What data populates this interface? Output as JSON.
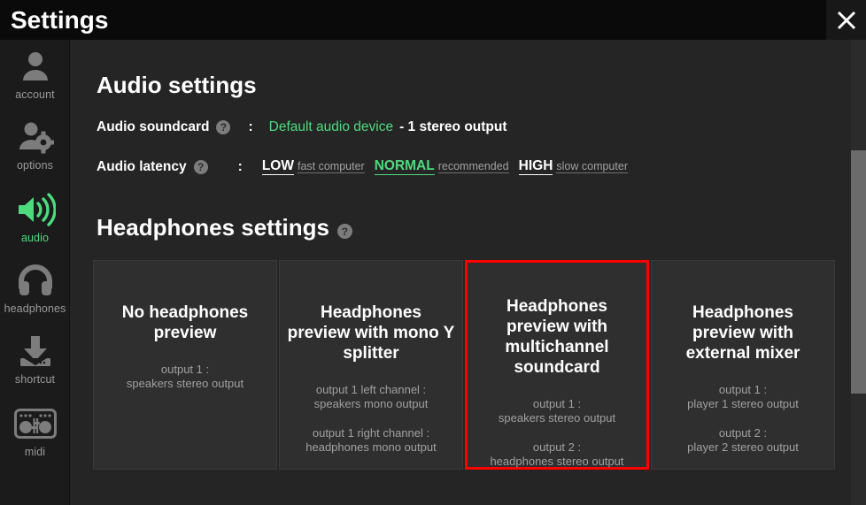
{
  "window": {
    "title": "Settings",
    "close_icon": "close-icon"
  },
  "sidebar": {
    "items": [
      {
        "id": "account",
        "label": "account",
        "icon": "user-icon",
        "active": false
      },
      {
        "id": "options",
        "label": "options",
        "icon": "user-gear-icon",
        "active": false
      },
      {
        "id": "audio",
        "label": "audio",
        "icon": "speaker-icon",
        "active": true
      },
      {
        "id": "headphones",
        "label": "headphones",
        "icon": "headphones-icon",
        "active": false
      },
      {
        "id": "shortcut",
        "label": "shortcut",
        "icon": "download-icon",
        "active": false
      },
      {
        "id": "midi",
        "label": "midi",
        "icon": "midi-controller-icon",
        "active": false
      }
    ]
  },
  "audio_settings": {
    "heading": "Audio settings",
    "soundcard": {
      "label": "Audio soundcard",
      "help_icon": "help-icon",
      "separator": ":",
      "device_name": "Default audio device",
      "device_detail": "- 1 stereo output"
    },
    "latency": {
      "label": "Audio latency",
      "help_icon": "help-icon",
      "separator": ":",
      "options": [
        {
          "name": "LOW",
          "hint": "fast computer",
          "selected": false
        },
        {
          "name": "NORMAL",
          "hint": "recommended",
          "selected": true
        },
        {
          "name": "HIGH",
          "hint": "slow computer",
          "selected": false
        }
      ]
    }
  },
  "headphones_settings": {
    "heading": "Headphones settings",
    "help_icon": "help-icon",
    "cards": [
      {
        "title": "No headphones preview",
        "lines": [
          "output 1 :\nspeakers stereo output"
        ],
        "selected": false
      },
      {
        "title": "Headphones preview with mono Y splitter",
        "lines": [
          "output 1 left channel :\nspeakers mono output",
          "output 1 right channel :\nheadphones mono output"
        ],
        "selected": false
      },
      {
        "title": "Headphones preview with multichannel soundcard",
        "lines": [
          "output 1 :\nspeakers stereo output",
          "output 2 :\nheadphones stereo output"
        ],
        "selected": true
      },
      {
        "title": "Headphones preview with external mixer",
        "lines": [
          "output 1 :\nplayer 1 stereo output",
          "output 2 :\nplayer 2 stereo output"
        ],
        "selected": false
      }
    ]
  },
  "colors": {
    "accent_green": "#4ddb7e",
    "selection_red": "#fe0000",
    "titlebar_bg": "#0a0a0a",
    "sidebar_bg": "#1b1b1b",
    "content_bg": "#252525",
    "card_bg": "#2f2f2f"
  },
  "scrollbar": {
    "name": "vertical-scrollbar"
  }
}
